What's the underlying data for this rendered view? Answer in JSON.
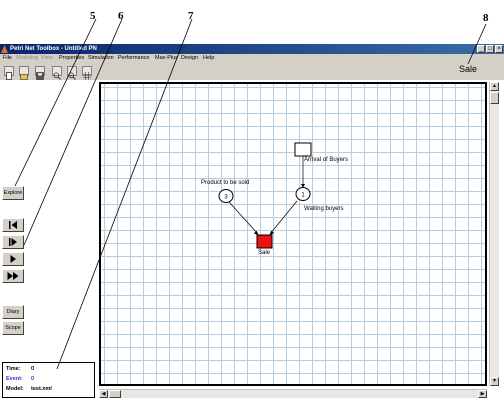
{
  "callouts": [
    "5",
    "6",
    "7",
    "8"
  ],
  "window": {
    "title": "Petri Net Toolbox - Untitled PN",
    "controls": [
      "_",
      "□",
      "×"
    ]
  },
  "menu": [
    "File",
    "Modeling",
    "View",
    "Properties",
    "Simulation",
    "Performance",
    "Max-Plus",
    "Design",
    "Help"
  ],
  "toolbar": {
    "icons": [
      "new-icon",
      "open-icon",
      "save-icon",
      "zoom-in-icon",
      "zoom-out-icon",
      "grid-icon"
    ]
  },
  "left_panel": {
    "explore_label": "Explore",
    "sim_controls": [
      "step-back-icon",
      "step-forward-icon",
      "play-icon",
      "fast-forward-icon"
    ],
    "diary_label": "Diary",
    "scope_label": "Scope",
    "info": {
      "time_label": "Time:",
      "time_value": "0",
      "event_label": "Event:",
      "event_value": "0",
      "model_label": "Model:",
      "model_value": "test.xml"
    },
    "colors": {
      "event": "#3333cc"
    }
  },
  "canvas": {
    "selected_name": "Sale",
    "places": [
      {
        "id": "product",
        "label": "Product to be sold",
        "tokens": "3"
      },
      {
        "id": "waiting",
        "label": "Waiting buyers",
        "tokens": "1"
      }
    ],
    "transitions": [
      {
        "id": "arrival",
        "label": "Arrival of Buyers",
        "color": "#ffffff"
      },
      {
        "id": "sale",
        "label": "Sale",
        "color": "#ee1111"
      }
    ]
  }
}
